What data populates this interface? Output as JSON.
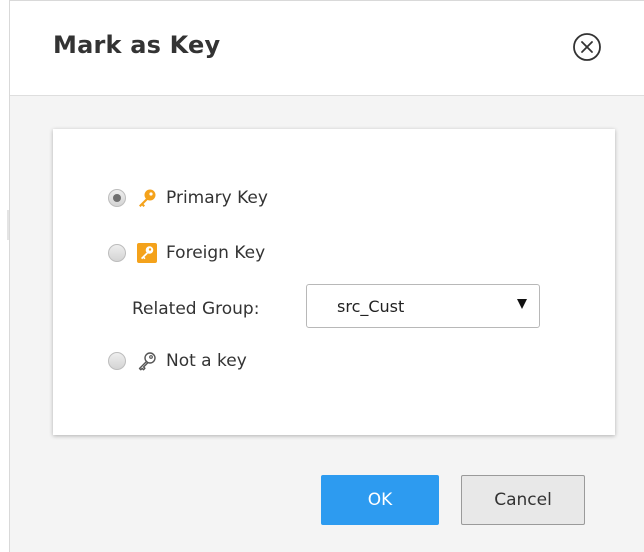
{
  "dialog": {
    "title": "Mark as Key",
    "close_icon": "circle-x-icon"
  },
  "options": [
    {
      "label": "Primary Key",
      "checked": true,
      "icon": "key-filled-icon",
      "icon_color": "#f4a21b"
    },
    {
      "label": "Foreign Key",
      "checked": false,
      "icon": "key-badge-icon",
      "icon_color": "#f4a21b"
    },
    {
      "label": "Not a key",
      "checked": false,
      "icon": "key-outline-icon",
      "icon_color": "#555555"
    }
  ],
  "related_group": {
    "label": "Related Group:",
    "selected": "src_Cust"
  },
  "buttons": {
    "ok_label": "OK",
    "cancel_label": "Cancel"
  },
  "colors": {
    "primary": "#2d9bf0",
    "key_accent": "#f4a21b"
  }
}
